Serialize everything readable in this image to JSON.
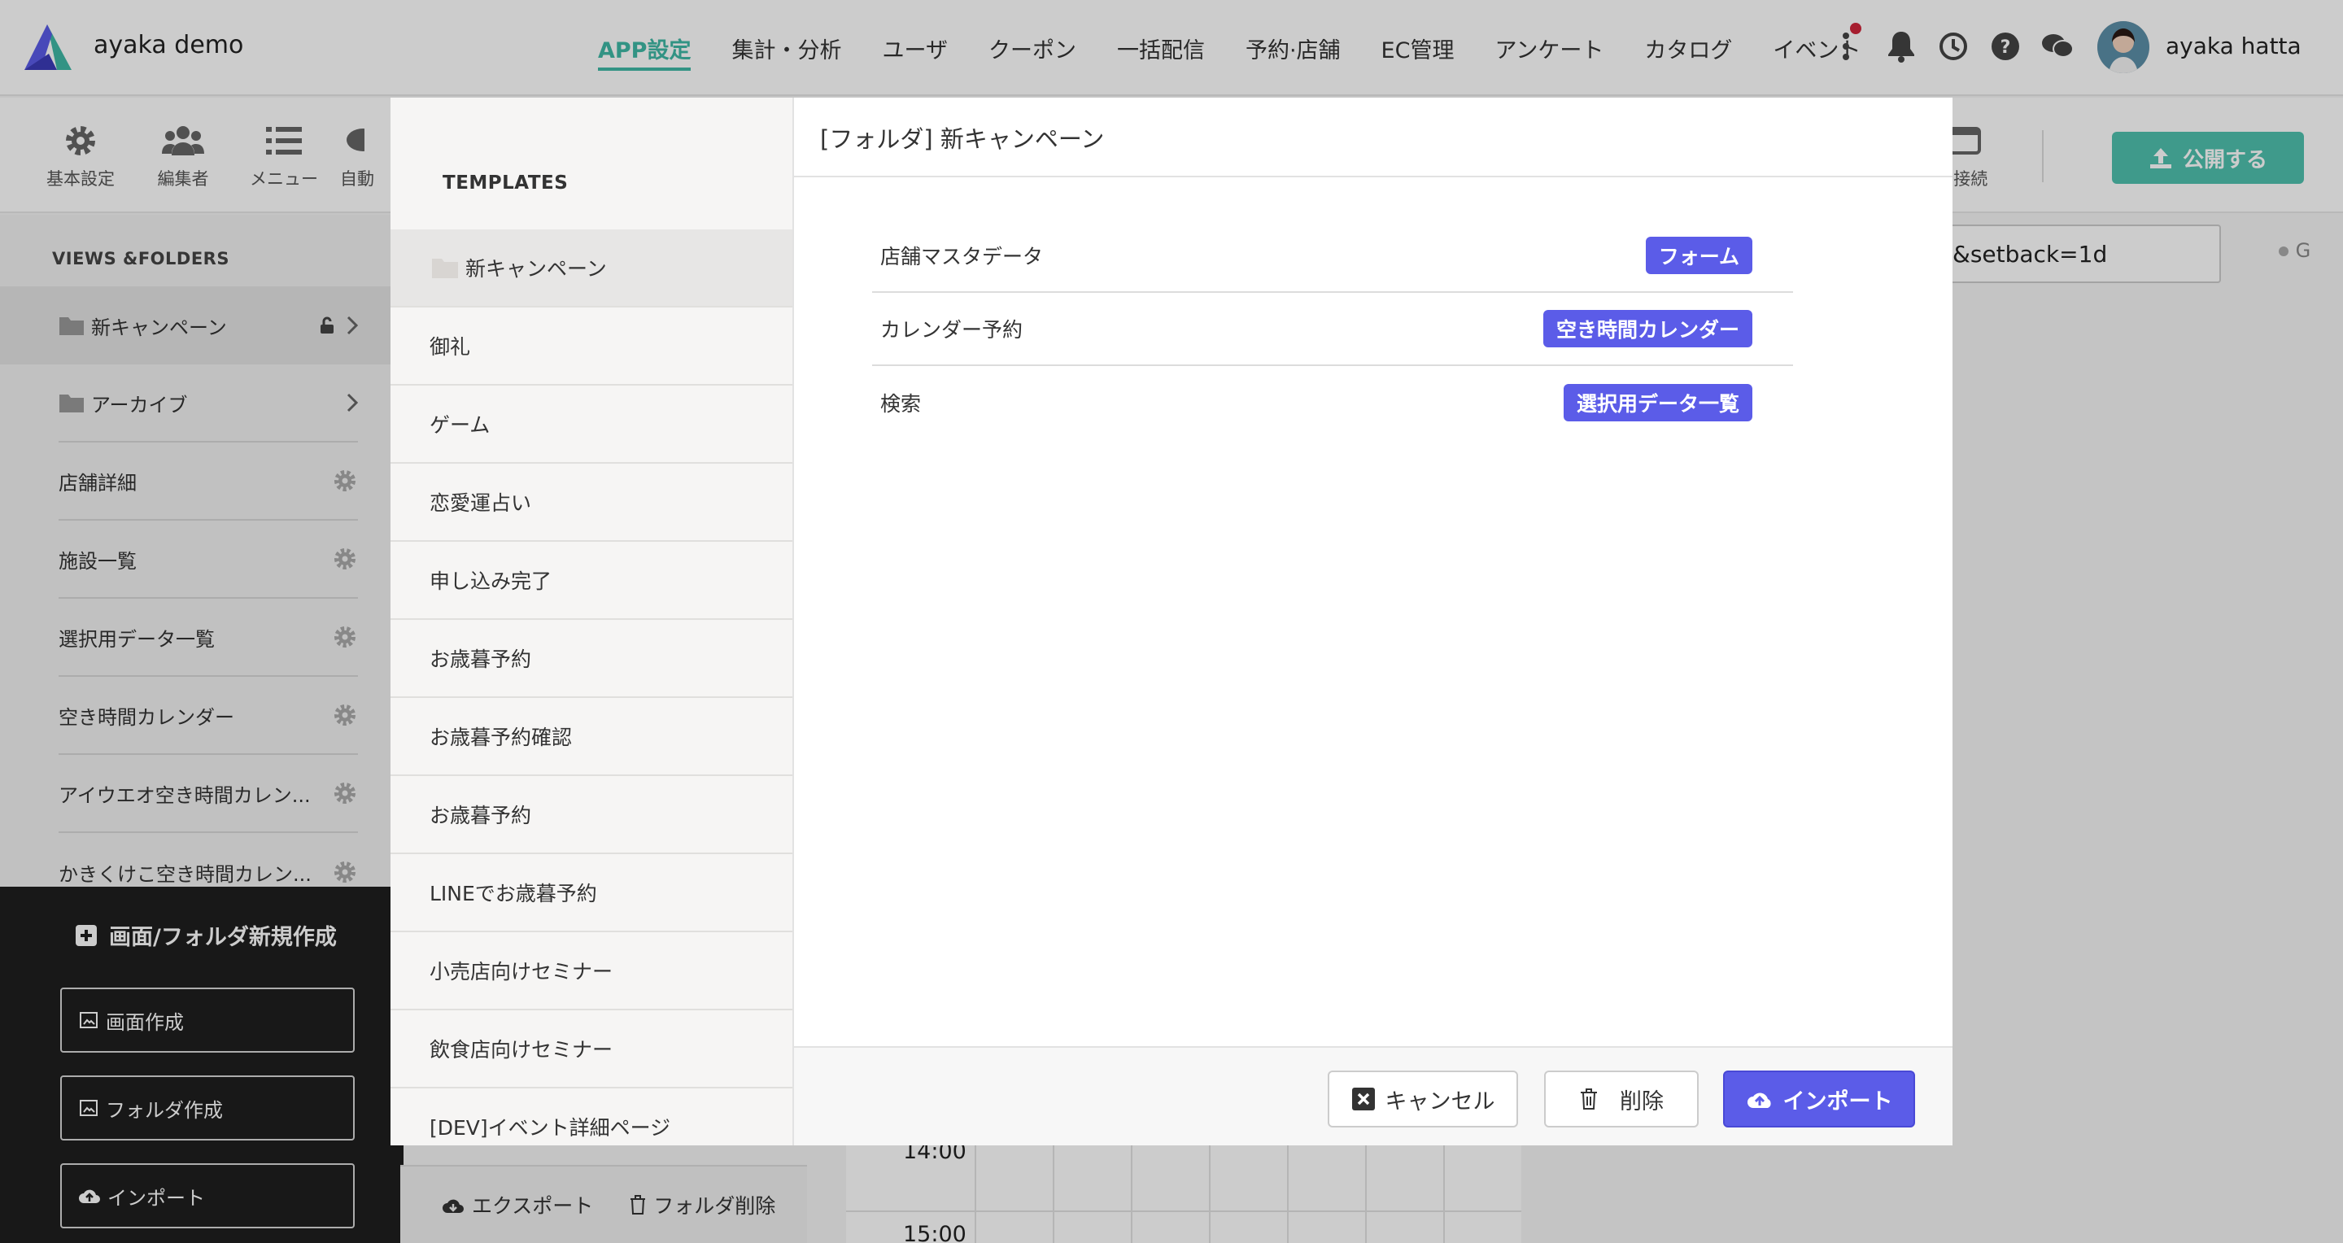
{
  "app": {
    "brand": "ayaka demo",
    "user_name": "ayaka hatta"
  },
  "nav": {
    "items": [
      {
        "label": "APP設定",
        "active": true
      },
      {
        "label": "集計・分析"
      },
      {
        "label": "ユーザ"
      },
      {
        "label": "クーポン"
      },
      {
        "label": "一括配信"
      },
      {
        "label": "予約·店舗"
      },
      {
        "label": "EC管理"
      },
      {
        "label": "アンケート"
      },
      {
        "label": "カタログ"
      },
      {
        "label": "イベント"
      }
    ]
  },
  "toolbar": {
    "basic": "基本設定",
    "editors": "編集者",
    "menu": "メニュー",
    "auto": "自動",
    "connect": "B接続",
    "publish": "公開する"
  },
  "sidebar": {
    "heading": "VIEWS &FOLDERS",
    "items": [
      {
        "label": "新キャンペーン"
      },
      {
        "label": "アーカイブ"
      },
      {
        "label": "店舗詳細"
      },
      {
        "label": "施設一覧"
      },
      {
        "label": "選択用データ一覧"
      },
      {
        "label": "空き時間カレンダー"
      },
      {
        "label": "アイウエオ空き時間カレン..."
      },
      {
        "label": "かきくけこ空き時間カレン..."
      }
    ]
  },
  "create_panel": {
    "title": "画面/フォルダ新規作成",
    "create_screen": "画面作成",
    "create_folder": "フォルダ作成",
    "import": "インポート"
  },
  "background": {
    "url_text": "&setback=1d",
    "status": "G",
    "times": [
      "14:00",
      "15:00"
    ]
  },
  "templates": {
    "heading": "TEMPLATES",
    "items": [
      {
        "label": "新キャンペーン",
        "selected": true
      },
      {
        "label": "御礼"
      },
      {
        "label": "ゲーム"
      },
      {
        "label": "恋愛運占い"
      },
      {
        "label": "申し込み完了"
      },
      {
        "label": "お歳暮予約"
      },
      {
        "label": "お歳暮予約確認"
      },
      {
        "label": "お歳暮予約"
      },
      {
        "label": "LINEでお歳暮予約"
      },
      {
        "label": "小売店向けセミナー"
      },
      {
        "label": "飲食店向けセミナー"
      },
      {
        "label": "[DEV]イベント詳細ページ"
      }
    ],
    "export": "エクスポート",
    "delete_folder": "フォルダ削除"
  },
  "modal": {
    "title": "[フォルダ] 新キャンペーン",
    "views": [
      {
        "name": "店舗マスタデータ",
        "type": "フォーム"
      },
      {
        "name": "カレンダー予約",
        "type": "空き時間カレンダー"
      },
      {
        "name": "検索",
        "type": "選択用データ一覧"
      }
    ],
    "cancel": "キャンセル",
    "delete": "削除",
    "import": "インポート"
  },
  "colors": {
    "accent_teal": "#3fb8a5",
    "badge_purple": "#5b5ce8",
    "notification_red": "#d0263b"
  }
}
